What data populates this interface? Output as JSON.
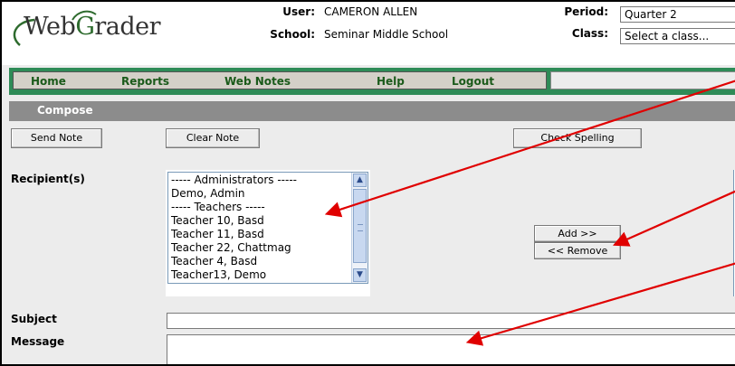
{
  "app": {
    "logo_text_before": "Web",
    "logo_text_g": "G",
    "logo_text_after": "rader"
  },
  "header": {
    "user_label": "User:",
    "user_value": "CAMERON ALLEN",
    "school_label": "School:",
    "school_value": "Seminar Middle School",
    "period_label": "Period:",
    "period_value": "Quarter 2",
    "class_label": "Class:",
    "class_value": "Select a class..."
  },
  "nav": {
    "items": [
      "Home",
      "Reports",
      "Web Notes",
      "Help",
      "Logout"
    ]
  },
  "compose": {
    "title": "Compose",
    "send_label": "Send Note",
    "clear_label": "Clear Note",
    "spell_label": "Check Spelling"
  },
  "recipients": {
    "label": "Recipient(s)",
    "items": [
      "----- Administrators -----",
      "Demo, Admin",
      "----- Teachers -----",
      "Teacher 10, Basd",
      "Teacher 11, Basd",
      "Teacher 22, Chattmag",
      "Teacher 4, Basd",
      "Teacher13, Demo"
    ],
    "add_label": "Add >>",
    "remove_label": "<< Remove"
  },
  "fields": {
    "subject_label": "Subject",
    "message_label": "Message"
  },
  "colors": {
    "nav_green": "#2e8b57",
    "compose_bar": "#8c8c8c",
    "annotation_red": "#e00000"
  },
  "icons": {
    "scroll_up": "chevron-up-icon",
    "scroll_down": "chevron-down-icon"
  }
}
